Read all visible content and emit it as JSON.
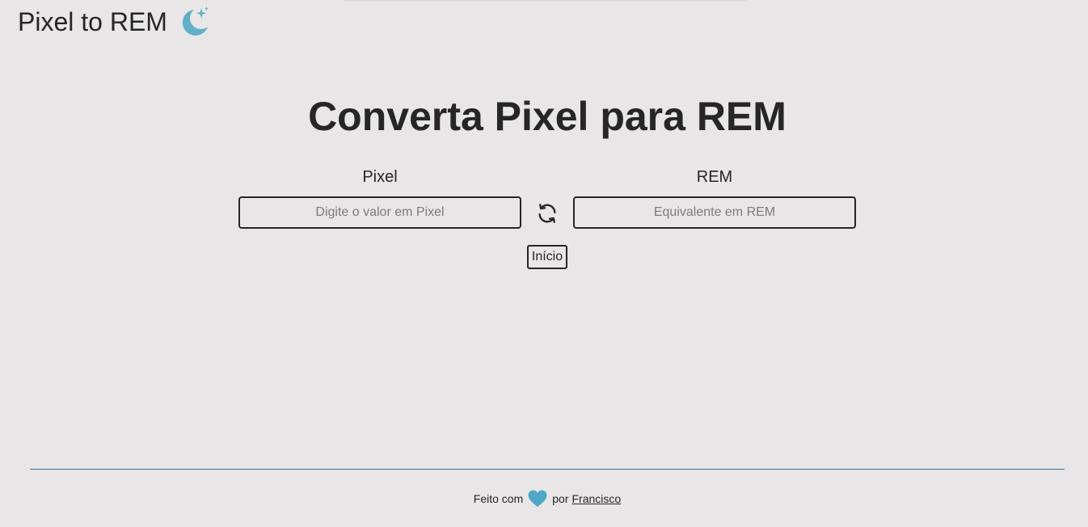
{
  "header": {
    "title": "Pixel to REM",
    "theme_icon": "moon-stars-icon"
  },
  "main": {
    "heading": "Converta Pixel para REM",
    "pixel": {
      "label": "Pixel",
      "value": "",
      "placeholder": "Digite o valor em Pixel"
    },
    "rem": {
      "label": "REM",
      "value": "",
      "placeholder": "Equivalente em REM"
    },
    "swap_icon": "swap-arrows-icon",
    "start_button_label": "Início"
  },
  "footer": {
    "made_with": "Feito com",
    "heart_icon": "heart-icon",
    "by": "por",
    "author": "Francisco"
  },
  "colors": {
    "background": "#e8e6e7",
    "accent": "#4fa8c7",
    "text": "#262626",
    "divider": "#3b6f8b"
  }
}
